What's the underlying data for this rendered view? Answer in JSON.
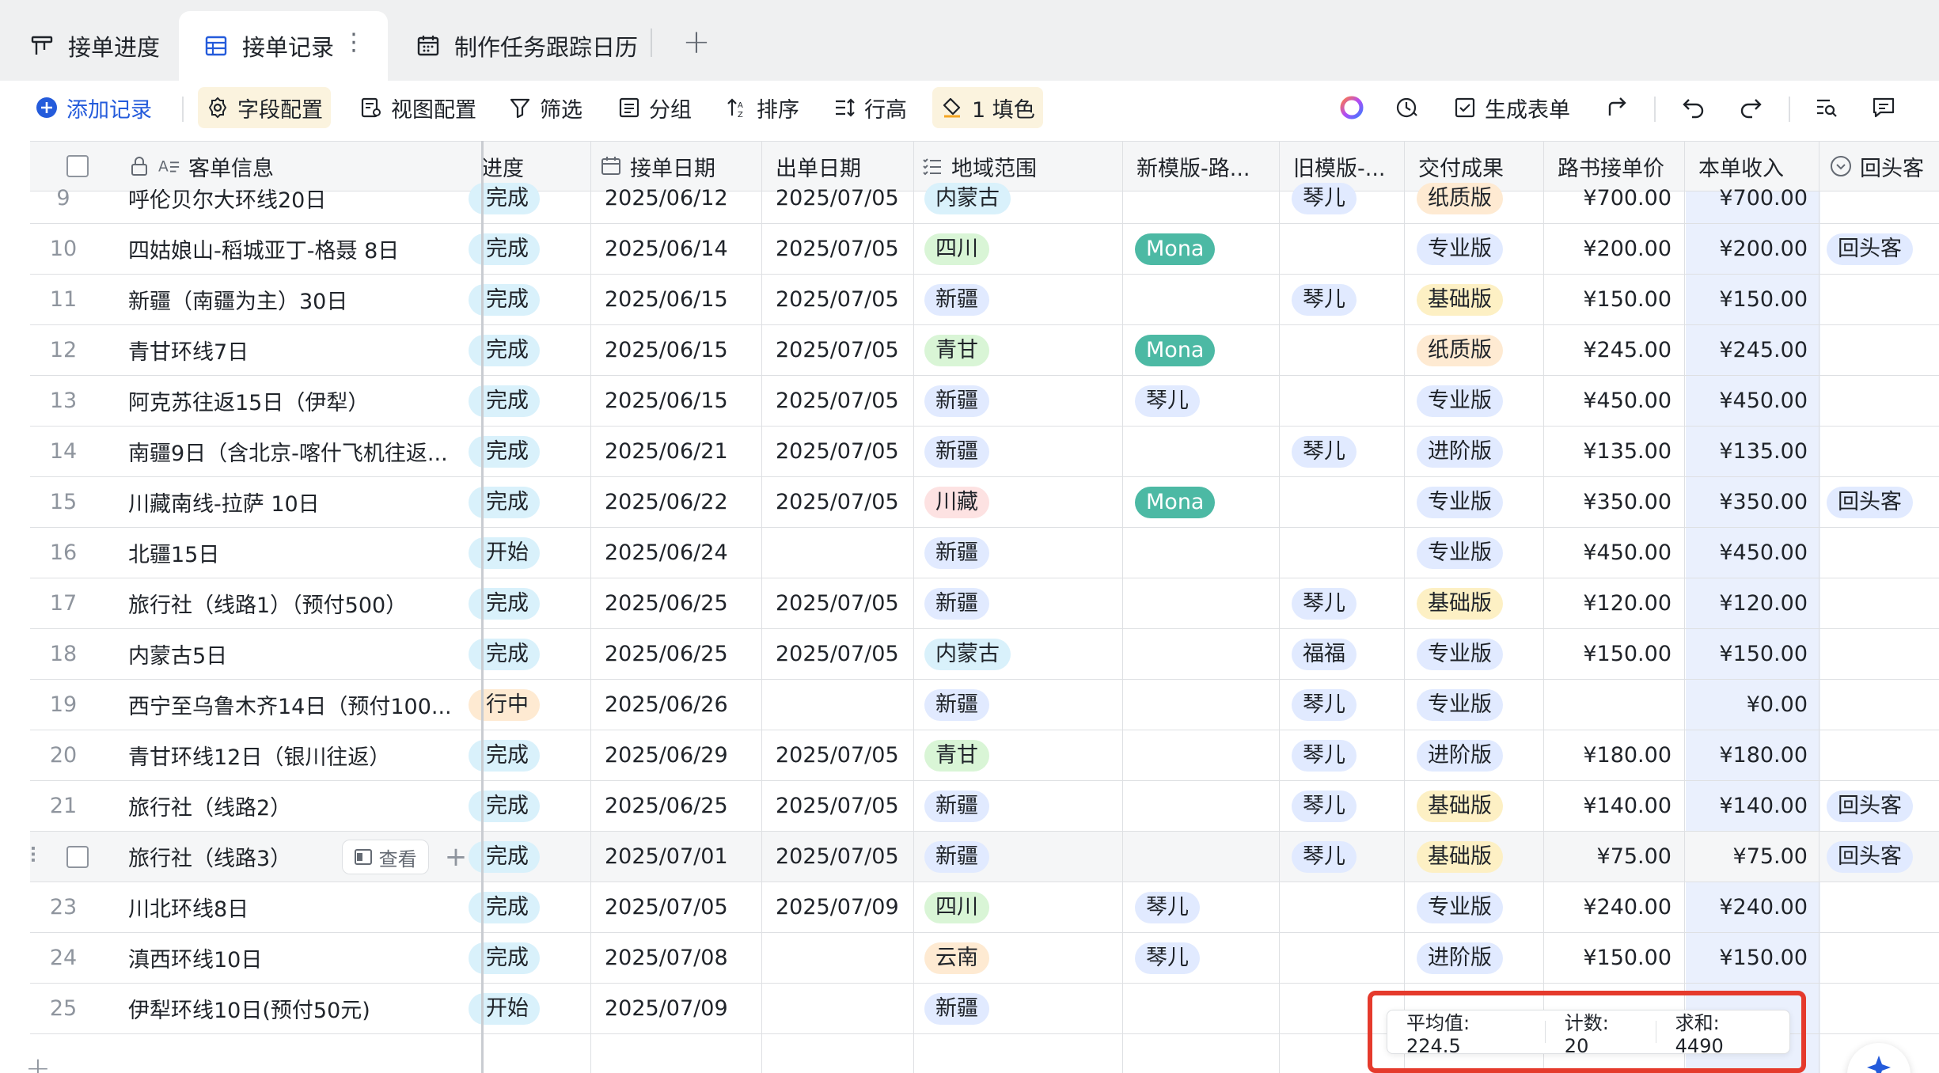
{
  "tabs": [
    {
      "label": "接单进度",
      "icon": "kanban-icon"
    },
    {
      "label": "接单记录",
      "icon": "table-icon"
    },
    {
      "label": "制作任务跟踪日历",
      "icon": "calendar-icon"
    }
  ],
  "tab_more": "⋮",
  "toolbar": {
    "add_record": "添加记录",
    "field_config": "字段配置",
    "view_config": "视图配置",
    "filter": "筛选",
    "group": "分组",
    "sort": "排序",
    "row_height": "行高",
    "fill": "1 填色",
    "generate_form": "生成表单"
  },
  "columns": {
    "customer": "客单信息",
    "progress": "进度",
    "order_date": "接单日期",
    "ship_date": "出单日期",
    "region": "地域范围",
    "new_template": "新模版-路...",
    "old_template": "旧模版-...",
    "deliverable": "交付成果",
    "unit_price": "路书接单价",
    "income": "本单收入",
    "returning": "回头客"
  },
  "row_action": {
    "view": "查看"
  },
  "rows": [
    {
      "n": "9",
      "customer": "呼伦贝尔大环线20日",
      "progress": "完成",
      "order_date": "2025/06/12",
      "ship_date": "2025/07/05",
      "region": "内蒙古",
      "new_t": "",
      "old_t": "琴儿",
      "deliverable": "纸质版",
      "price": "¥700.00",
      "income": "¥700.00",
      "returning": ""
    },
    {
      "n": "10",
      "customer": "四姑娘山-稻城亚丁-格聂 8日",
      "progress": "完成",
      "order_date": "2025/06/14",
      "ship_date": "2025/07/05",
      "region": "四川",
      "new_t": "Mona",
      "old_t": "",
      "deliverable": "专业版",
      "price": "¥200.00",
      "income": "¥200.00",
      "returning": "回头客"
    },
    {
      "n": "11",
      "customer": "新疆（南疆为主）30日",
      "progress": "完成",
      "order_date": "2025/06/15",
      "ship_date": "2025/07/05",
      "region": "新疆",
      "new_t": "",
      "old_t": "琴儿",
      "deliverable": "基础版",
      "price": "¥150.00",
      "income": "¥150.00",
      "returning": ""
    },
    {
      "n": "12",
      "customer": "青甘环线7日",
      "progress": "完成",
      "order_date": "2025/06/15",
      "ship_date": "2025/07/05",
      "region": "青甘",
      "new_t": "Mona",
      "old_t": "",
      "deliverable": "纸质版",
      "price": "¥245.00",
      "income": "¥245.00",
      "returning": ""
    },
    {
      "n": "13",
      "customer": "阿克苏往返15日（伊犁）",
      "progress": "完成",
      "order_date": "2025/06/15",
      "ship_date": "2025/07/05",
      "region": "新疆",
      "new_t": "琴儿",
      "old_t": "",
      "deliverable": "专业版",
      "price": "¥450.00",
      "income": "¥450.00",
      "returning": ""
    },
    {
      "n": "14",
      "customer": "南疆9日（含北京-喀什飞机往返...",
      "progress": "完成",
      "order_date": "2025/06/21",
      "ship_date": "2025/07/05",
      "region": "新疆",
      "new_t": "",
      "old_t": "琴儿",
      "deliverable": "进阶版",
      "price": "¥135.00",
      "income": "¥135.00",
      "returning": ""
    },
    {
      "n": "15",
      "customer": "川藏南线-拉萨 10日",
      "progress": "完成",
      "order_date": "2025/06/22",
      "ship_date": "2025/07/05",
      "region": "川藏",
      "new_t": "Mona",
      "old_t": "",
      "deliverable": "专业版",
      "price": "¥350.00",
      "income": "¥350.00",
      "returning": "回头客"
    },
    {
      "n": "16",
      "customer": "北疆15日",
      "progress": "开始",
      "order_date": "2025/06/24",
      "ship_date": "",
      "region": "新疆",
      "new_t": "",
      "old_t": "",
      "deliverable": "专业版",
      "price": "¥450.00",
      "income": "¥450.00",
      "returning": ""
    },
    {
      "n": "17",
      "customer": "旅行社（线路1）（预付500）",
      "progress": "完成",
      "order_date": "2025/06/25",
      "ship_date": "2025/07/05",
      "region": "新疆",
      "new_t": "",
      "old_t": "琴儿",
      "deliverable": "基础版",
      "price": "¥120.00",
      "income": "¥120.00",
      "returning": ""
    },
    {
      "n": "18",
      "customer": "内蒙古5日",
      "progress": "完成",
      "order_date": "2025/06/25",
      "ship_date": "2025/07/05",
      "region": "内蒙古",
      "new_t": "",
      "old_t": "福福",
      "deliverable": "专业版",
      "price": "¥150.00",
      "income": "¥150.00",
      "returning": ""
    },
    {
      "n": "19",
      "customer": "西宁至乌鲁木齐14日（预付100...",
      "progress": "行中",
      "order_date": "2025/06/26",
      "ship_date": "",
      "region": "新疆",
      "new_t": "",
      "old_t": "琴儿",
      "deliverable": "专业版",
      "price": "",
      "income": "¥0.00",
      "returning": ""
    },
    {
      "n": "20",
      "customer": "青甘环线12日（银川往返）",
      "progress": "完成",
      "order_date": "2025/06/29",
      "ship_date": "2025/07/05",
      "region": "青甘",
      "new_t": "",
      "old_t": "琴儿",
      "deliverable": "进阶版",
      "price": "¥180.00",
      "income": "¥180.00",
      "returning": ""
    },
    {
      "n": "21",
      "customer": "旅行社（线路2）",
      "progress": "完成",
      "order_date": "2025/06/25",
      "ship_date": "2025/07/05",
      "region": "新疆",
      "new_t": "",
      "old_t": "琴儿",
      "deliverable": "基础版",
      "price": "¥140.00",
      "income": "¥140.00",
      "returning": "回头客"
    },
    {
      "n": "",
      "customer": "旅行社（线路3）",
      "progress": "完成",
      "order_date": "2025/07/01",
      "ship_date": "2025/07/05",
      "region": "新疆",
      "new_t": "",
      "old_t": "琴儿",
      "deliverable": "基础版",
      "price": "¥75.00",
      "income": "¥75.00",
      "returning": "回头客"
    },
    {
      "n": "23",
      "customer": "川北环线8日",
      "progress": "完成",
      "order_date": "2025/07/05",
      "ship_date": "2025/07/09",
      "region": "四川",
      "new_t": "琴儿",
      "old_t": "",
      "deliverable": "专业版",
      "price": "¥240.00",
      "income": "¥240.00",
      "returning": ""
    },
    {
      "n": "24",
      "customer": "滇西环线10日",
      "progress": "完成",
      "order_date": "2025/07/08",
      "ship_date": "",
      "region": "云南",
      "new_t": "琴儿",
      "old_t": "",
      "deliverable": "进阶版",
      "price": "¥150.00",
      "income": "¥150.00",
      "returning": ""
    },
    {
      "n": "25",
      "customer": "伊犁环线10日(预付50元)",
      "progress": "开始",
      "order_date": "2025/07/09",
      "ship_date": "",
      "region": "新疆",
      "new_t": "",
      "old_t": "",
      "deliverable": "",
      "price": "",
      "income": "",
      "returning": ""
    }
  ],
  "stats": {
    "avg": "平均值: 224.5",
    "count": "计数: 20",
    "sum": "求和: 4490"
  },
  "colors": {
    "accent": "#245bdb",
    "highlight": "#e53a2c",
    "income_bg": "#eaf0fd"
  }
}
